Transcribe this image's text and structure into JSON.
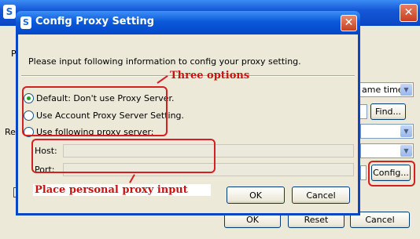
{
  "background_window": {
    "app_icon": "app-icon",
    "close_icon": "close-icon",
    "fragment_p": "P",
    "fragment_re": "Re",
    "combo_time": "ame time",
    "find_button": "Find...",
    "config_button": "Config...",
    "ok_button": "OK",
    "reset_button": "Reset",
    "cancel_button": "Cancel"
  },
  "dialog": {
    "title": "Config Proxy Setting",
    "app_icon": "app-icon",
    "close_icon": "close-icon",
    "instruction": "Please input following information to config your proxy setting.",
    "options": [
      {
        "label": "Default: Don't use Proxy Server.",
        "selected": true
      },
      {
        "label": "Use Account Proxy Server Setting.",
        "selected": false
      },
      {
        "label": "Use following proxy server:",
        "selected": false
      }
    ],
    "host_label": "Host:",
    "host_value": "",
    "port_label": "Port:",
    "port_value": "",
    "ok_button": "OK",
    "cancel_button": "Cancel"
  },
  "annotations": {
    "options_callout": "Three options",
    "proxy_input_callout": "Place personal proxy input"
  },
  "colors": {
    "title_blue": "#0a46c4",
    "annotation_red": "#d32020",
    "radio_selected": "#21a121"
  }
}
